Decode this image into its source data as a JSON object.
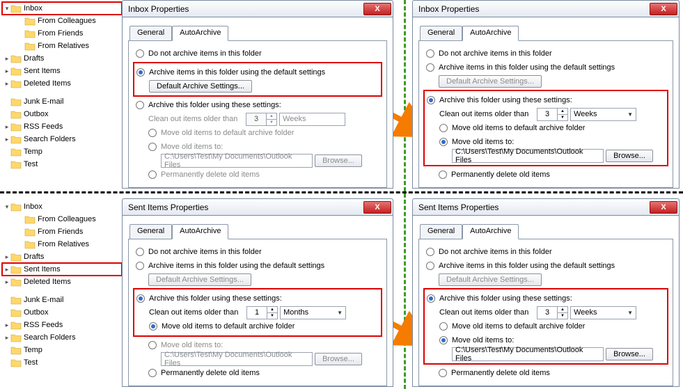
{
  "tree": {
    "items": [
      {
        "label": "Inbox",
        "exp": "▾"
      },
      {
        "label": "From Colleagues",
        "indent": 1
      },
      {
        "label": "From Friends",
        "indent": 1
      },
      {
        "label": "From Relatives",
        "indent": 1
      },
      {
        "label": "Drafts",
        "exp": "▸"
      },
      {
        "label": "Sent Items",
        "exp": "▸"
      },
      {
        "label": "Deleted Items",
        "exp": "▸"
      },
      {
        "label": "Junk E-mail"
      },
      {
        "label": "Outbox"
      },
      {
        "label": "RSS Feeds",
        "exp": "▸"
      },
      {
        "label": "Search Folders",
        "exp": "▸"
      },
      {
        "label": "Temp"
      },
      {
        "label": "Test"
      }
    ]
  },
  "common": {
    "tab_general": "General",
    "tab_autoarchive": "AutoArchive",
    "opt_noarchive": "Do not archive items in this folder",
    "opt_default": "Archive items in this folder using the default settings",
    "btn_default": "Default Archive Settings...",
    "opt_these": "Archive this folder using these settings:",
    "lbl_cleanout": "Clean out items older than",
    "opt_movedef": "Move old items to default archive folder",
    "opt_moveto": "Move old items to:",
    "btn_browse": "Browse...",
    "opt_perm": "Permanently delete old items",
    "path": "C:\\Users\\Test\\My Documents\\Outlook Files",
    "unit_weeks": "Weeks",
    "unit_months": "Months"
  },
  "d1": {
    "title": "Inbox Properties",
    "clean_n": "3",
    "unit": "Weeks"
  },
  "d2": {
    "title": "Inbox Properties",
    "clean_n": "3",
    "unit": "Weeks"
  },
  "d3": {
    "title": "Sent Items Properties",
    "clean_n": "1",
    "unit": "Months"
  },
  "d4": {
    "title": "Sent Items Properties",
    "clean_n": "3",
    "unit": "Weeks"
  }
}
